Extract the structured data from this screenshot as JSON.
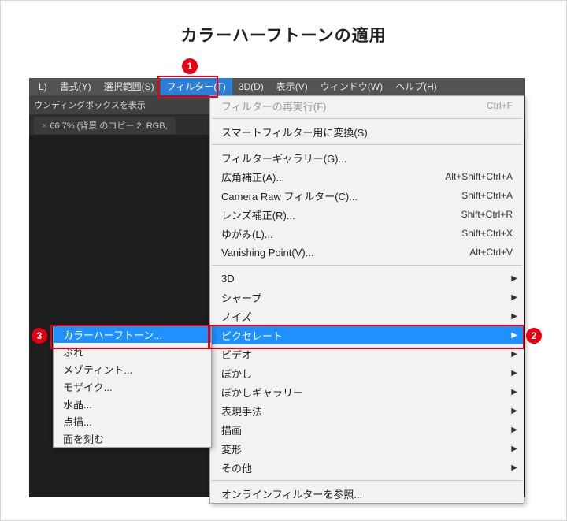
{
  "page_title": "カラーハーフトーンの適用",
  "badges": {
    "b1": "1",
    "b2": "2",
    "b3": "3"
  },
  "menubar": {
    "items": [
      "L)",
      "書式(Y)",
      "選択範囲(S)",
      "フィルター(T)",
      "3D(D)",
      "表示(V)",
      "ウィンドウ(W)",
      "ヘルプ(H)"
    ],
    "active_index": 3
  },
  "toolbar_text": "ウンディングボックスを表示",
  "document_tab": "66.7% (背景 のコピー 2, RGB,",
  "filter_menu": {
    "items": [
      {
        "label": "フィルターの再実行(F)",
        "shortcut": "Ctrl+F",
        "disabled": true
      },
      {
        "sep": true
      },
      {
        "label": "スマートフィルター用に変換(S)"
      },
      {
        "sep": true
      },
      {
        "label": "フィルターギャラリー(G)..."
      },
      {
        "label": "広角補正(A)...",
        "shortcut": "Alt+Shift+Ctrl+A"
      },
      {
        "label": "Camera Raw フィルター(C)...",
        "shortcut": "Shift+Ctrl+A"
      },
      {
        "label": "レンズ補正(R)...",
        "shortcut": "Shift+Ctrl+R"
      },
      {
        "label": "ゆがみ(L)...",
        "shortcut": "Shift+Ctrl+X"
      },
      {
        "label": "Vanishing Point(V)...",
        "shortcut": "Alt+Ctrl+V"
      },
      {
        "sep": true
      },
      {
        "label": "3D",
        "submenu": true
      },
      {
        "label": "シャープ",
        "submenu": true
      },
      {
        "label": "ノイズ",
        "submenu": true
      },
      {
        "label": "ピクセレート",
        "submenu": true,
        "highlight": true
      },
      {
        "label": "ビデオ",
        "submenu": true
      },
      {
        "label": "ぼかし",
        "submenu": true
      },
      {
        "label": "ぼかしギャラリー",
        "submenu": true
      },
      {
        "label": "表現手法",
        "submenu": true
      },
      {
        "label": "描画",
        "submenu": true
      },
      {
        "label": "変形",
        "submenu": true
      },
      {
        "label": "その他",
        "submenu": true
      },
      {
        "sep": true
      },
      {
        "label": "オンラインフィルターを参照..."
      }
    ]
  },
  "pixelate_submenu": {
    "items": [
      {
        "label": "カラーハーフトーン...",
        "highlight": true
      },
      {
        "label": "ぶれ"
      },
      {
        "label": "メゾティント..."
      },
      {
        "label": "モザイク..."
      },
      {
        "label": "水晶..."
      },
      {
        "label": "点描..."
      },
      {
        "label": "面を刻む"
      }
    ]
  }
}
